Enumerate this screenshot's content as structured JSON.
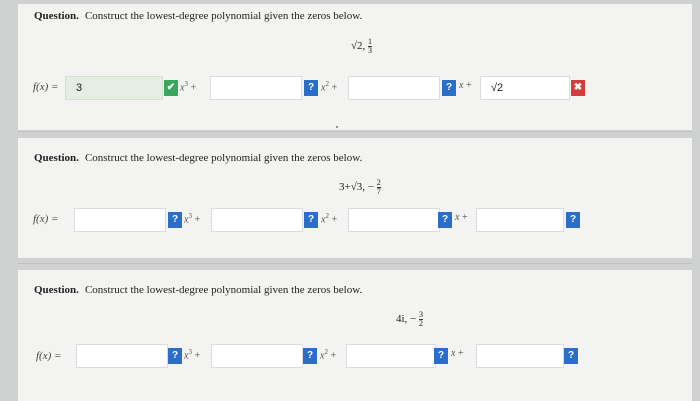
{
  "questions": [
    {
      "label": "Question.",
      "text": "Construct the lowest-degree polynomial given the zeros below.",
      "zeros_main": "√2,",
      "zeros_frac": {
        "num": "1",
        "den": "3"
      },
      "fx_label": "f(x) =",
      "coef1_value": "3",
      "coef1_status": "✔",
      "term1": "x",
      "term1_exp": "3",
      "term1_plus": "+",
      "coef2_status": "?",
      "term2": "x",
      "term2_exp": "2",
      "term2_plus": "+",
      "coef3_status": "?",
      "term3": "x",
      "term3_plus": "+",
      "const_value": "√2",
      "const_status": "✖"
    },
    {
      "label": "Question.",
      "text": "Construct the lowest-degree polynomial given the zeros below.",
      "zeros_main": "3+√3, −",
      "zeros_frac": {
        "num": "2",
        "den": "7"
      },
      "fx_label": "f(x) =",
      "coef1_status": "?",
      "term1": "x",
      "term1_exp": "3",
      "term1_plus": "+",
      "coef2_status": "?",
      "term2": "x",
      "term2_exp": "2",
      "term2_plus": "+",
      "coef3_status": "?",
      "term3": "x",
      "term3_plus": "+",
      "const_status": "?"
    },
    {
      "label": "Question.",
      "text": "Construct the lowest-degree polynomial given the zeros below.",
      "zeros_main": "4i, −",
      "zeros_frac": {
        "num": "3",
        "den": "2"
      },
      "fx_label": "f(x) =",
      "coef1_status": "?",
      "term1": "x",
      "term1_exp": "3",
      "term1_plus": "+",
      "coef2_status": "?",
      "term2": "x",
      "term2_exp": "2",
      "term2_plus": "+",
      "coef3_status": "?",
      "term3": "x",
      "term3_plus": "+",
      "const_status": "?"
    }
  ],
  "colors": {
    "correct": "#3aa65b",
    "incorrect": "#d63c3c",
    "unanswered": "#2a6ec9"
  }
}
